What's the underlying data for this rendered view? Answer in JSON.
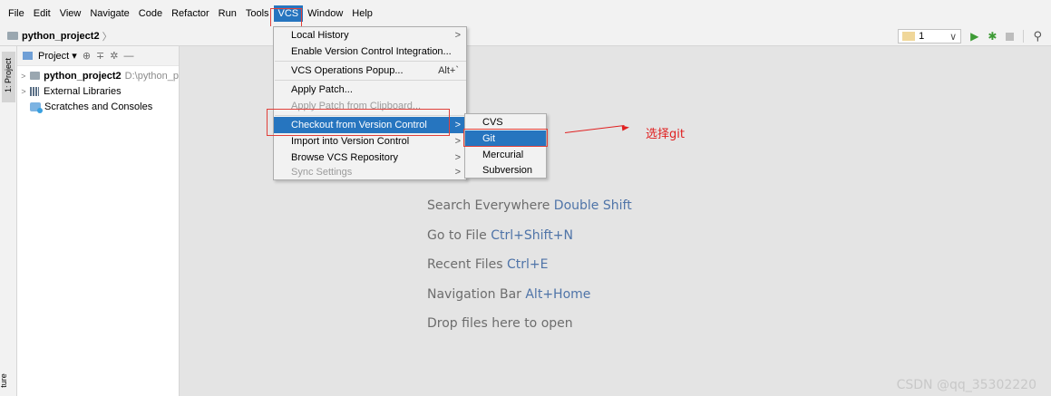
{
  "menubar": {
    "items": [
      "File",
      "Edit",
      "View",
      "Navigate",
      "Code",
      "Refactor",
      "Run",
      "Tools",
      "VCS",
      "Window",
      "Help"
    ]
  },
  "navbar": {
    "breadcrumb": "python_project2",
    "run_config": "1"
  },
  "stripe": {
    "tab_label": "1: Project",
    "bottom_label": "ture"
  },
  "project_panel": {
    "title": "Project",
    "tree": [
      {
        "label": "python_project2",
        "path": "D:\\python_p"
      },
      {
        "label": "External Libraries"
      },
      {
        "label": "Scratches and Consoles"
      }
    ]
  },
  "vcs_menu": {
    "items": [
      {
        "label": "Local History",
        "submenu": true
      },
      {
        "label": "Enable Version Control Integration..."
      },
      {
        "label": "VCS Operations Popup...",
        "shortcut": "Alt+`"
      },
      {
        "label": "Apply Patch..."
      },
      {
        "label": "Apply Patch from Clipboard...",
        "disabled": true
      },
      {
        "label": "Checkout from Version Control",
        "submenu": true,
        "selected": true
      },
      {
        "label": "Import into Version Control",
        "submenu": true
      },
      {
        "label": "Browse VCS Repository",
        "submenu": true
      },
      {
        "label": "Sync Settings",
        "submenu": true,
        "disabled": true
      }
    ]
  },
  "checkout_submenu": {
    "items": [
      {
        "label": "CVS"
      },
      {
        "label": "Git",
        "selected": true
      },
      {
        "label": "Mercurial"
      },
      {
        "label": "Subversion"
      }
    ]
  },
  "editor_hints": [
    {
      "label": "Search Everywhere",
      "shortcut": "Double Shift"
    },
    {
      "label": "Go to File",
      "shortcut": "Ctrl+Shift+N"
    },
    {
      "label": "Recent Files",
      "shortcut": "Ctrl+E"
    },
    {
      "label": "Navigation Bar",
      "shortcut": "Alt+Home"
    },
    {
      "label": "Drop files here to open",
      "shortcut": ""
    }
  ],
  "annotation": "选择git",
  "watermark": "CSDN @qq_35302220",
  "colors": {
    "selection": "#2675bf",
    "annotation_red": "#e02020",
    "shortcut_blue": "#4f74a8"
  }
}
